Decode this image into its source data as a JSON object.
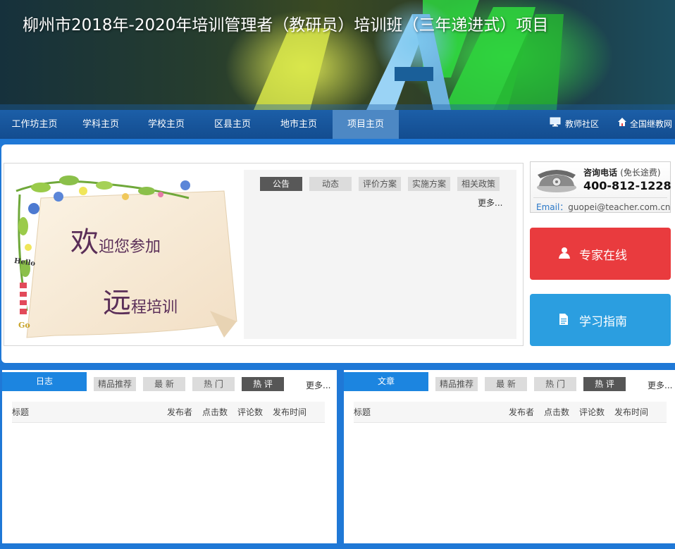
{
  "banner": {
    "title": "柳州市2018年-2020年培训管理者（教研员）培训班（三年递进式）项目"
  },
  "nav": {
    "items": [
      {
        "label": "工作坊主页",
        "active": false
      },
      {
        "label": "学科主页",
        "active": false
      },
      {
        "label": "学校主页",
        "active": false
      },
      {
        "label": "区县主页",
        "active": false
      },
      {
        "label": "地市主页",
        "active": false
      },
      {
        "label": "项目主页",
        "active": true
      }
    ],
    "right": [
      {
        "label": "教师社区",
        "icon": "monitor-icon"
      },
      {
        "label": "全国继教网",
        "icon": "home-icon"
      }
    ]
  },
  "welcome": {
    "line1_big": "欢",
    "line1_rest": "迎您参加",
    "line2_big": "远",
    "line2_rest": "程培训",
    "hello": "Hello",
    "go": "Go"
  },
  "news": {
    "tabs": [
      {
        "label": "公告",
        "active": true
      },
      {
        "label": "动态",
        "active": false
      },
      {
        "label": "评价方案",
        "active": false
      },
      {
        "label": "实施方案",
        "active": false
      },
      {
        "label": "相关政策",
        "active": false
      }
    ],
    "more": "更多..."
  },
  "contact": {
    "label": "咨询电话",
    "label_sub": "(免长途费)",
    "phone": "400-812-1228",
    "email_label": "Email：",
    "email": "guopei@teacher.com.cn"
  },
  "buttons": {
    "expert": "专家在线",
    "guide": "学习指南"
  },
  "colors": {
    "nav_bg": "#134c8f",
    "nav_active": "#4d88c4",
    "expert_btn": "#e93b3e",
    "guide_btn": "#2b9ee0",
    "panel_title": "#1c85e0",
    "page_bg": "#1f78d6"
  },
  "panels": [
    {
      "title": "日志",
      "tabs": [
        {
          "label": "精品推荐",
          "active": false
        },
        {
          "label": "最 新",
          "active": false
        },
        {
          "label": "热 门",
          "active": false
        },
        {
          "label": "热 评",
          "active": true
        }
      ],
      "more": "更多...",
      "columns": [
        "标题",
        "发布者",
        "点击数",
        "评论数",
        "发布时间"
      ]
    },
    {
      "title": "文章",
      "tabs": [
        {
          "label": "精品推荐",
          "active": false
        },
        {
          "label": "最 新",
          "active": false
        },
        {
          "label": "热 门",
          "active": false
        },
        {
          "label": "热 评",
          "active": true
        }
      ],
      "more": "更多...",
      "columns": [
        "标题",
        "发布者",
        "点击数",
        "评论数",
        "发布时间"
      ]
    }
  ]
}
